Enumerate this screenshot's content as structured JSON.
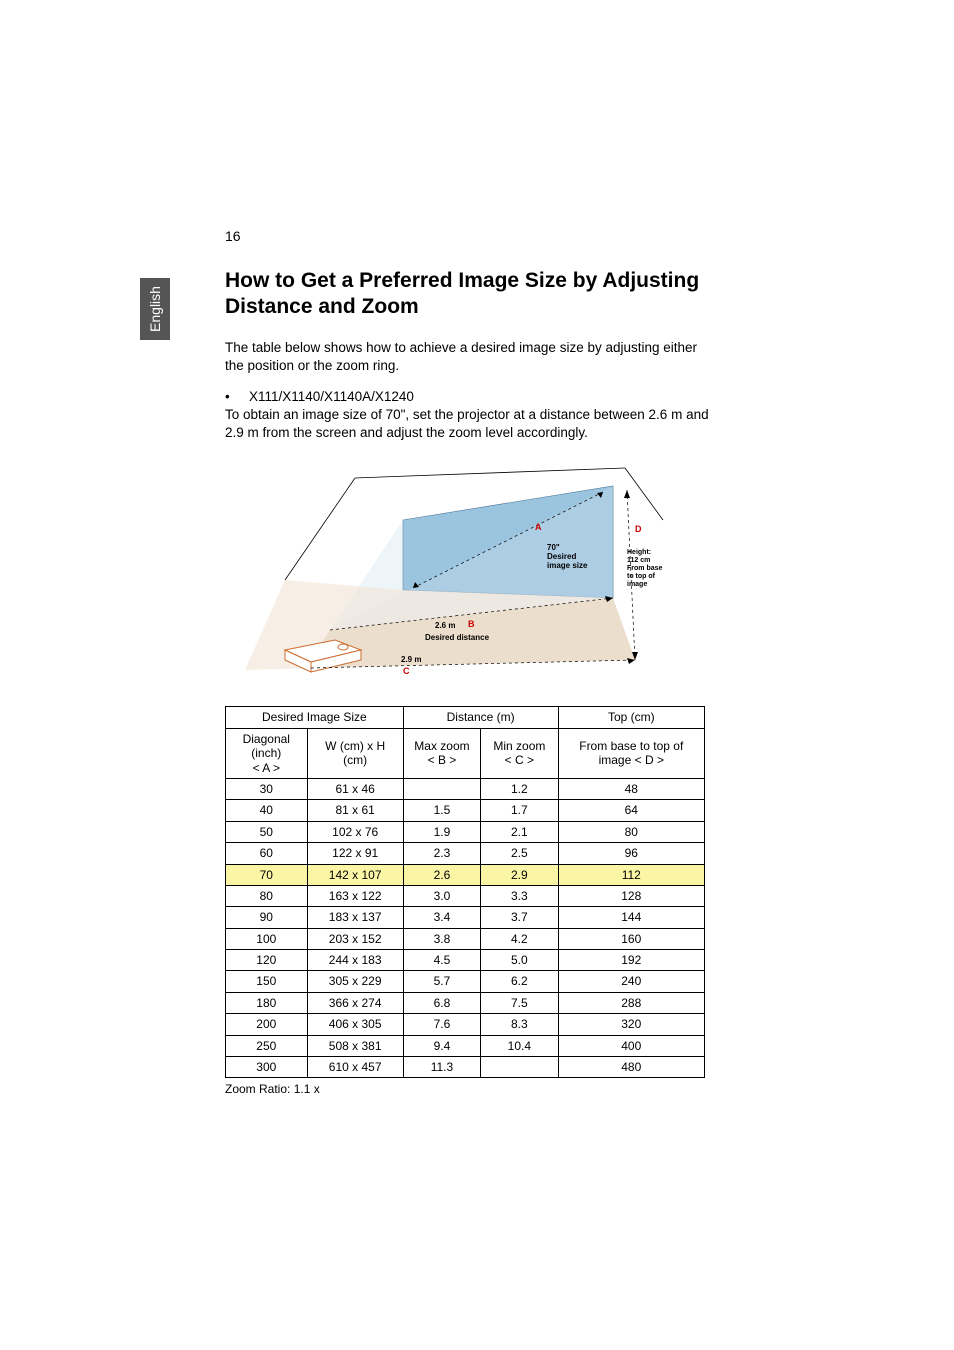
{
  "page_number": "16",
  "language_tab": "English",
  "heading": "How to Get a Preferred Image Size by Adjusting Distance and Zoom",
  "intro": "The table below shows how to achieve a desired image size by adjusting either the position or the zoom ring.",
  "models_line": "X111/X1140/X1140A/X1240",
  "example_line": "To obtain an image size of 70\", set the projector at a distance between 2.6 m and 2.9 m from the screen and adjust the zoom level accordingly.",
  "diagram": {
    "label_A": "A",
    "label_B": "B",
    "label_C": "C",
    "label_D": "D",
    "size_label_1": "70\"",
    "size_label_2": "Desired",
    "size_label_3": "image size",
    "height_label_1": "Height:",
    "height_label_2": "112 cm",
    "height_label_3": "From base",
    "height_label_4": "to top of",
    "height_label_5": "image",
    "dist_b": "2.6 m",
    "dist_label": "Desired distance",
    "dist_c": "2.9 m"
  },
  "table": {
    "group_headers": {
      "size": "Desired Image Size",
      "distance": "Distance (m)",
      "top": "Top (cm)"
    },
    "sub_headers": {
      "diag1": "Diagonal (inch)",
      "diag2": "< A >",
      "wh": "W (cm) x H (cm)",
      "max1": "Max zoom",
      "max2": "< B >",
      "min1": "Min zoom",
      "min2": "< C >",
      "top1": "From base to top of",
      "top2": "image < D >"
    },
    "rows": [
      {
        "diag": "30",
        "wh": "61 x 46",
        "max": "",
        "min": "1.2",
        "top": "48",
        "hl": false
      },
      {
        "diag": "40",
        "wh": "81 x 61",
        "max": "1.5",
        "min": "1.7",
        "top": "64",
        "hl": false
      },
      {
        "diag": "50",
        "wh": "102 x 76",
        "max": "1.9",
        "min": "2.1",
        "top": "80",
        "hl": false
      },
      {
        "diag": "60",
        "wh": "122 x 91",
        "max": "2.3",
        "min": "2.5",
        "top": "96",
        "hl": false
      },
      {
        "diag": "70",
        "wh": "142 x 107",
        "max": "2.6",
        "min": "2.9",
        "top": "112",
        "hl": true
      },
      {
        "diag": "80",
        "wh": "163 x 122",
        "max": "3.0",
        "min": "3.3",
        "top": "128",
        "hl": false
      },
      {
        "diag": "90",
        "wh": "183 x 137",
        "max": "3.4",
        "min": "3.7",
        "top": "144",
        "hl": false
      },
      {
        "diag": "100",
        "wh": "203 x 152",
        "max": "3.8",
        "min": "4.2",
        "top": "160",
        "hl": false
      },
      {
        "diag": "120",
        "wh": "244 x 183",
        "max": "4.5",
        "min": "5.0",
        "top": "192",
        "hl": false
      },
      {
        "diag": "150",
        "wh": "305 x 229",
        "max": "5.7",
        "min": "6.2",
        "top": "240",
        "hl": false
      },
      {
        "diag": "180",
        "wh": "366 x 274",
        "max": "6.8",
        "min": "7.5",
        "top": "288",
        "hl": false
      },
      {
        "diag": "200",
        "wh": "406 x 305",
        "max": "7.6",
        "min": "8.3",
        "top": "320",
        "hl": false
      },
      {
        "diag": "250",
        "wh": "508 x 381",
        "max": "9.4",
        "min": "10.4",
        "top": "400",
        "hl": false
      },
      {
        "diag": "300",
        "wh": "610 x 457",
        "max": "11.3",
        "min": "",
        "top": "480",
        "hl": false
      }
    ],
    "footnote": "Zoom Ratio: 1.1 x"
  }
}
